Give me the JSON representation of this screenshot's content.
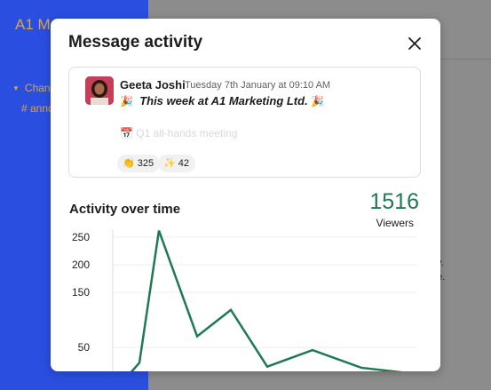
{
  "background": {
    "workspace_name": "A1 Ma",
    "channels_heading": "Chan",
    "channel_item": "# anno",
    "fragment_1": "y.",
    "fragment_2": "e."
  },
  "modal": {
    "title": "Message activity",
    "close_icon": "close-icon"
  },
  "message": {
    "author": "Geeta Joshi",
    "timestamp": "Tuesday 7th January at 09:10 AM",
    "party_icon": "party-popper-icon",
    "text": "This week at A1 Marketing Ltd.",
    "faded_text": "Q1 all-hands meeting",
    "reactions": [
      {
        "icon": "hands-icon",
        "count": "325"
      },
      {
        "icon": "sparkles-icon",
        "count": "42"
      }
    ]
  },
  "activity": {
    "title": "Activity over time",
    "viewers_count": "1516",
    "viewers_label": "Viewers"
  },
  "colors": {
    "sidebar": "#2a4fe0",
    "line": "#1f7a53",
    "accent_text": "#1f7a53"
  },
  "chart_data": {
    "type": "line",
    "title": "Activity over time",
    "xlabel": "",
    "ylabel": "",
    "y_ticks": [
      250,
      200,
      150,
      50
    ],
    "ylim": [
      0,
      280
    ],
    "grid": true,
    "values": [
      0,
      22,
      262,
      70,
      118,
      15,
      45,
      13,
      2
    ]
  }
}
